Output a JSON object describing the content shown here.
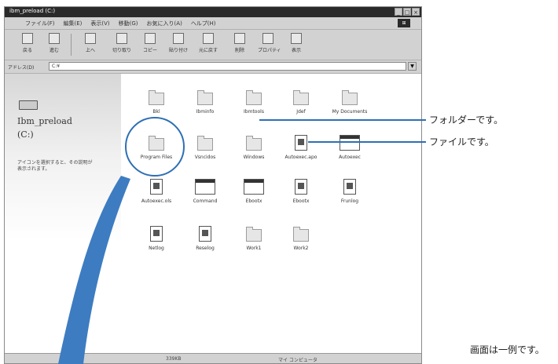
{
  "window": {
    "title": "ibm_preload (C:)",
    "controls": [
      "_",
      "□",
      "×"
    ]
  },
  "menubar": {
    "items": [
      "ファイル(F)",
      "編集(E)",
      "表示(V)",
      "移動(G)",
      "お気に入り(A)",
      "ヘルプ(H)"
    ]
  },
  "toolbar": {
    "buttons": [
      "戻る",
      "進む",
      "上へ",
      "切り取り",
      "コピー",
      "貼り付け",
      "元に戻す",
      "削除",
      "プロパティ",
      "表示"
    ]
  },
  "address": {
    "label": "アドレス(D)",
    "value": "C:¥"
  },
  "left_pane": {
    "drive_name": "Ibm_preload",
    "drive_letter": "(C:)",
    "hint": "アイコンを選択すると、その説明が表示されます。"
  },
  "items": [
    {
      "name": "Bkl",
      "type": "folder"
    },
    {
      "name": "Ibminfo",
      "type": "folder"
    },
    {
      "name": "Ibmtools",
      "type": "folder"
    },
    {
      "name": "Jdef",
      "type": "folder"
    },
    {
      "name": "My Documents",
      "type": "folder"
    },
    {
      "name": "Program Files",
      "type": "folder"
    },
    {
      "name": "Vsncidos",
      "type": "folder"
    },
    {
      "name": "Windows",
      "type": "folder"
    },
    {
      "name": "Autoexec.apo",
      "type": "doc"
    },
    {
      "name": "Autoexec",
      "type": "app"
    },
    {
      "name": "Autoexec.ols",
      "type": "doc"
    },
    {
      "name": "Command",
      "type": "app"
    },
    {
      "name": "Ebootx",
      "type": "app"
    },
    {
      "name": "Ebootx",
      "type": "doc"
    },
    {
      "name": "Frunlog",
      "type": "doc"
    },
    {
      "name": "Netlog",
      "type": "doc"
    },
    {
      "name": "Reselog",
      "type": "doc"
    },
    {
      "name": "Work1",
      "type": "folder"
    },
    {
      "name": "Work2",
      "type": "folder"
    }
  ],
  "statusbar": {
    "size": "339KB",
    "location": "マイ コンピュータ"
  },
  "annotations": {
    "folder_label": "フォルダーです。",
    "file_label": "ファイルです。",
    "caption": "画面は一例です。"
  },
  "colors": {
    "annotation_blue": "#2e6fb4",
    "titlebar": "#2a2a2a",
    "chrome": "#d2d2d2"
  }
}
